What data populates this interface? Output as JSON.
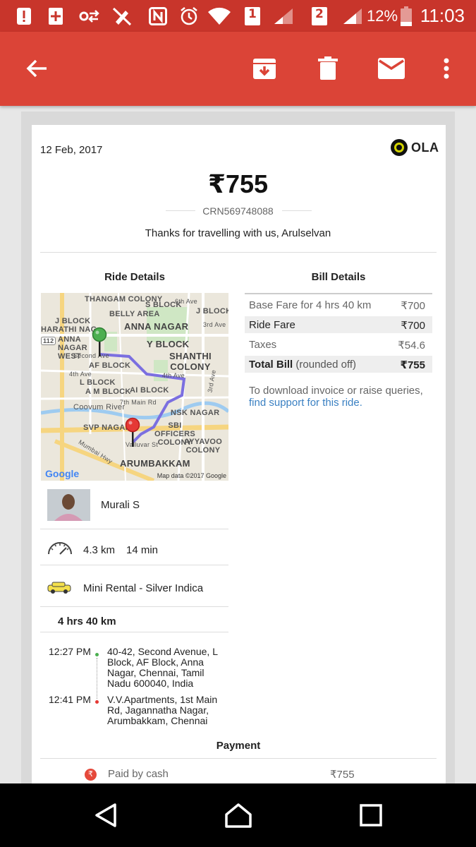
{
  "status_bar": {
    "battery_percent": "12%",
    "time": "11:03",
    "sim1_label": "1",
    "sim2_label": "2"
  },
  "app_bar": {
    "icons": [
      "back-arrow-icon",
      "archive-icon",
      "delete-icon",
      "mail-icon",
      "more-vert-icon"
    ]
  },
  "email": {
    "date": "12 Feb, 2017",
    "brand": "OLA",
    "amount": "₹755",
    "crn": "CRN569748088",
    "thanks": "Thanks for travelling with us, Arulselvan",
    "ride_details_title": "Ride Details",
    "bill_details_title": "Bill Details",
    "map": {
      "labels": [
        "THANGAM COLONY",
        "S BLOCK",
        "6th Ave",
        "BELLY AREA",
        "J BLOCK",
        "J BLOCK",
        "ANNA NAGAR",
        "HARATHI NAG",
        "3rd Ave",
        "ANNA NAGAR WEST",
        "Y BLOCK",
        "Second Ave",
        "SHANTHI COLONY",
        "AF BLOCK",
        "4th Ave",
        "4th Ave",
        "L BLOCK",
        "A M BLOCK",
        "AI BLOCK",
        "7th Main Rd",
        "Coovum River",
        "NSK NAGAR",
        "SVP NAGAR",
        "SBI OFFICERS COLONY",
        "Valluvar St",
        "AYYAVOO COLONY",
        "ARUMBAKKAM",
        "Mumbai Hwy",
        "3rd Ave"
      ],
      "shield": "112",
      "google": "Google",
      "credit": "Map data ©2017 Google"
    },
    "driver_name": "Murali S",
    "distance": "4.3 km",
    "duration": "14 min",
    "vehicle": "Mini Rental - Silver Indica",
    "package": "4 hrs 40 km",
    "pickup_time": "12:27 PM",
    "pickup_address": "40-42, Second Avenue, L Block, AF Block, Anna Nagar, Chennai, Tamil Nadu 600040, India",
    "drop_time": "12:41 PM",
    "drop_address": "V.V.Apartments, 1st Main Rd, Jagannatha Nagar, Arumbakkam, Chennai",
    "bill": [
      {
        "label": "Base Fare for 4 hrs 40 km",
        "value": "₹700"
      },
      {
        "label": "Ride Fare",
        "value": "₹700"
      },
      {
        "label": "Taxes",
        "value": "₹54.6"
      },
      {
        "label": "Total Bill",
        "suffix": "(rounded off)",
        "value": "₹755"
      }
    ],
    "support_text": "To download invoice or raise queries,",
    "support_link": "find support for this ride.",
    "payment_title": "Payment",
    "payment_method": "Paid by cash",
    "payment_amount": "₹755"
  },
  "colors": {
    "status_bar": "#c8352b",
    "app_bar": "#db4437",
    "link": "#3a80c2",
    "route": "#7b6fe0",
    "pickup_pin": "#4caf50",
    "drop_pin": "#e53935"
  }
}
